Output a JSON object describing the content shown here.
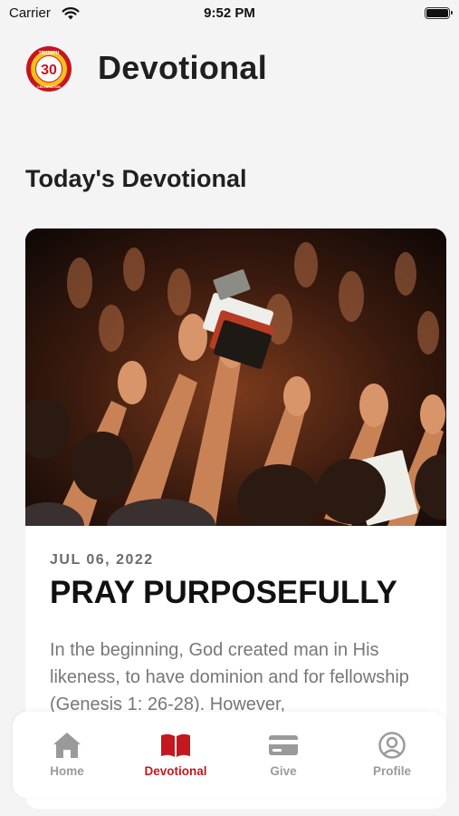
{
  "status_bar": {
    "carrier": "Carrier",
    "time": "9:52 PM"
  },
  "header": {
    "title": "Devotional",
    "logo": {
      "number": "30",
      "top_text": "TRIUMPH",
      "bottom_text": "CELEBRATION"
    }
  },
  "section_title": "Today's Devotional",
  "devotional": {
    "date": "JUL 06, 2022",
    "title": "PRAY PURPOSEFULLY",
    "excerpt": "In the beginning, God created man in His likeness, to have dominion and for fellowship (Genesis 1: 26-28). However,"
  },
  "tab_bar": {
    "active": "Devotional",
    "items": [
      {
        "label": "Home",
        "icon": "house-icon"
      },
      {
        "label": "Devotional",
        "icon": "book-icon"
      },
      {
        "label": "Give",
        "icon": "credit-card-icon"
      },
      {
        "label": "Profile",
        "icon": "person-circle-icon"
      }
    ]
  },
  "colors": {
    "accent": "#c4171e",
    "inactive": "#9a9a9a",
    "background": "#f4f4f4"
  }
}
